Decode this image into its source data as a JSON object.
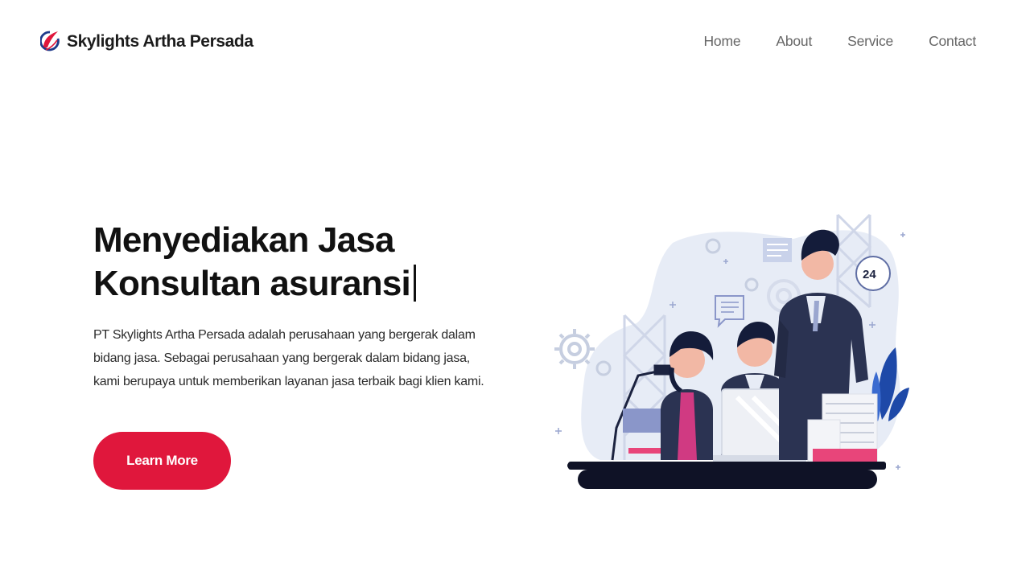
{
  "brand": {
    "name": "Skylights Artha Persada",
    "logo_icon": "skylights-logo-icon",
    "colors": {
      "red": "#e0173c",
      "blue": "#1e3a8a"
    }
  },
  "nav": {
    "items": [
      {
        "label": "Home"
      },
      {
        "label": "About"
      },
      {
        "label": "Service"
      },
      {
        "label": "Contact"
      }
    ]
  },
  "hero": {
    "title_line1": "Menyediakan Jasa",
    "title_line2": "Konsultan asuransi",
    "description": "PT Skylights Artha Persada adalah perusahaan yang bergerak dalam bidang jasa. Sebagai perusahaan yang bergerak dalam bidang jasa, kami berupaya untuk memberikan layanan jasa terbaik bagi klien kami.",
    "cta_label": "Learn More",
    "cta_color": "#e0173c"
  },
  "illustration": {
    "badge_text": "24",
    "icon": "office-team-illustration"
  }
}
